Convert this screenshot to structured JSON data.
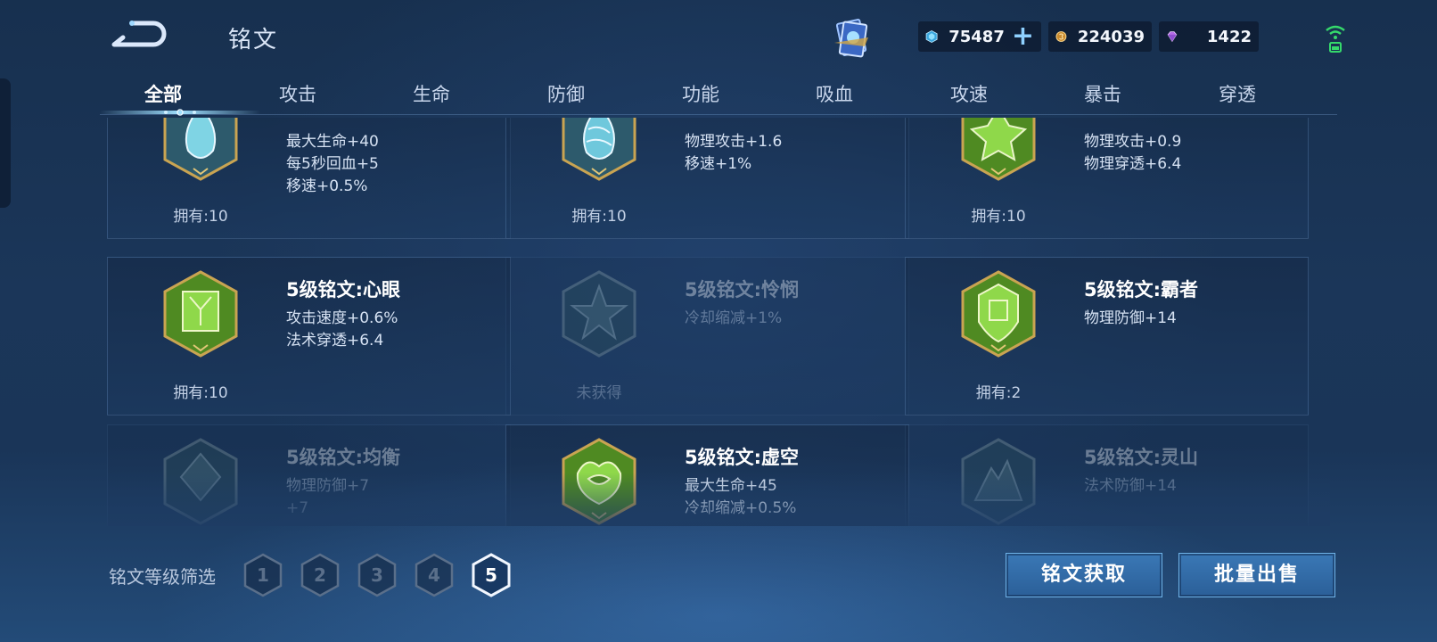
{
  "header": {
    "title": "铭文",
    "currencies": [
      {
        "name": "diamond-coupon",
        "value": "75487",
        "icon": "blue-gem-icon",
        "color": "#5ec3f0"
      },
      {
        "name": "gold",
        "value": "224039",
        "icon": "gold-coin-icon",
        "color": "#d9a441"
      },
      {
        "name": "gems",
        "value": "1422",
        "icon": "purple-diamond-icon",
        "color": "#c086f0"
      }
    ],
    "plus_label": "+"
  },
  "tabs": [
    {
      "label": "全部",
      "active": true
    },
    {
      "label": "攻击"
    },
    {
      "label": "生命"
    },
    {
      "label": "防御"
    },
    {
      "label": "功能"
    },
    {
      "label": "吸血"
    },
    {
      "label": "攻速"
    },
    {
      "label": "暴击"
    },
    {
      "label": "穿透"
    }
  ],
  "inscriptions": [
    {
      "name": "",
      "stats": [
        "最大生命+40",
        "每5秒回血+5",
        "移速+0.5%"
      ],
      "owned": "拥有:10",
      "color": "teal",
      "obtained": true
    },
    {
      "name": "",
      "stats": [
        "物理攻击+1.6",
        "移速+1%"
      ],
      "owned": "拥有:10",
      "color": "teal",
      "obtained": true
    },
    {
      "name": "",
      "stats": [
        "物理攻击+0.9",
        "物理穿透+6.4"
      ],
      "owned": "拥有:10",
      "color": "green",
      "obtained": true
    },
    {
      "name": "5级铭文:心眼",
      "stats": [
        "攻击速度+0.6%",
        "法术穿透+6.4"
      ],
      "owned": "拥有:10",
      "color": "green",
      "obtained": true
    },
    {
      "name": "5级铭文:怜悯",
      "stats": [
        "冷却缩减+1%"
      ],
      "owned": "未获得",
      "color": "green",
      "obtained": false
    },
    {
      "name": "5级铭文:霸者",
      "stats": [
        "物理防御+14"
      ],
      "owned": "拥有:2",
      "color": "green",
      "obtained": true
    },
    {
      "name": "5级铭文:均衡",
      "stats": [
        "物理防御+7",
        "+7"
      ],
      "owned": "",
      "color": "green",
      "obtained": false
    },
    {
      "name": "5级铭文:虚空",
      "stats": [
        "最大生命+45",
        "冷却缩减+0.5%"
      ],
      "owned": "",
      "color": "green",
      "obtained": true
    },
    {
      "name": "5级铭文:灵山",
      "stats": [
        "法术防御+14"
      ],
      "owned": "",
      "color": "green",
      "obtained": false
    }
  ],
  "footer": {
    "filter_label": "铭文等级筛选",
    "levels": [
      "1",
      "2",
      "3",
      "4",
      "5"
    ],
    "active_level": "5",
    "obtain_button": "铭文获取",
    "sell_button": "批量出售"
  }
}
